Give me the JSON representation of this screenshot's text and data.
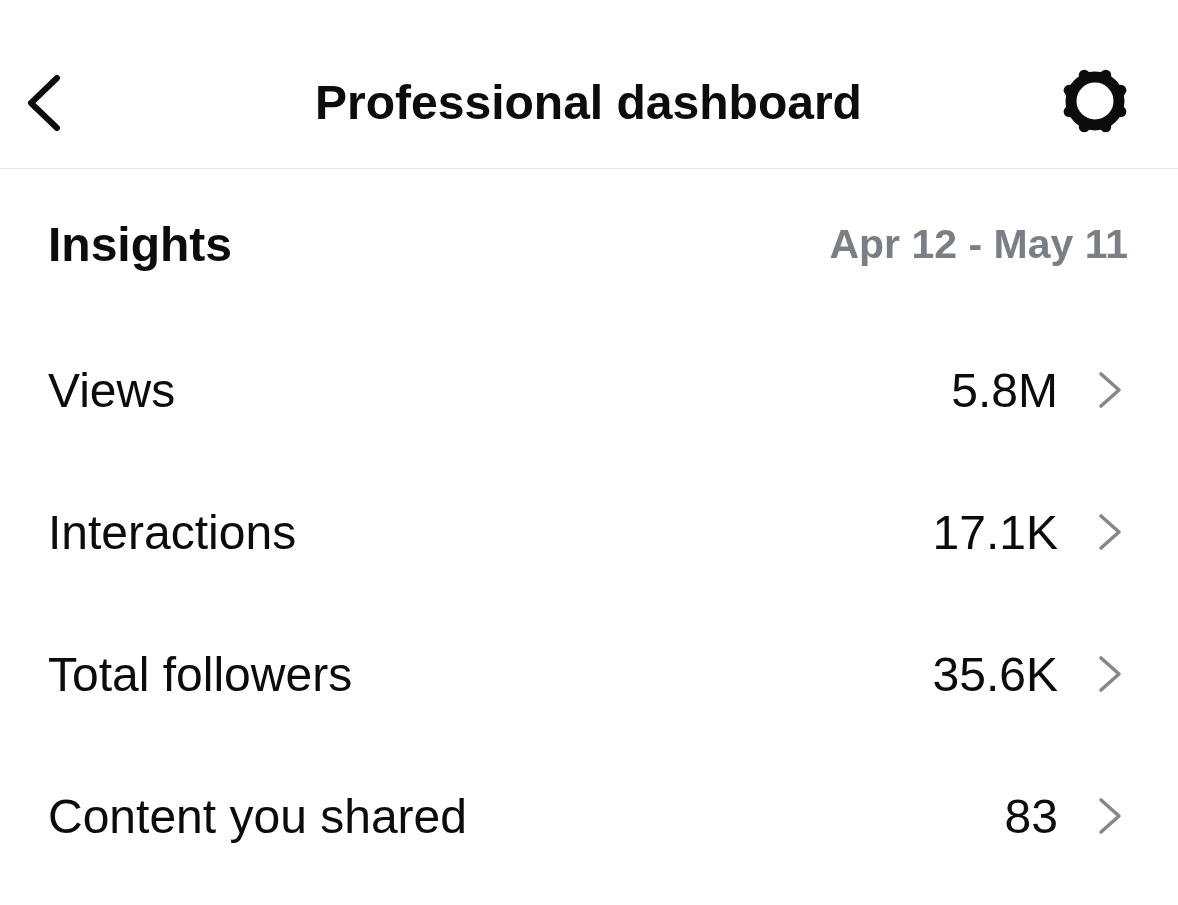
{
  "header": {
    "title": "Professional dashboard"
  },
  "insights": {
    "title": "Insights",
    "date_range": "Apr 12 - May 11",
    "metrics": [
      {
        "label": "Views",
        "value": "5.8M"
      },
      {
        "label": "Interactions",
        "value": "17.1K"
      },
      {
        "label": "Total followers",
        "value": "35.6K"
      },
      {
        "label": "Content you shared",
        "value": "83"
      }
    ]
  }
}
